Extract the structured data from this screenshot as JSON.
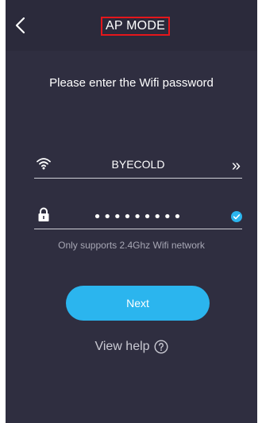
{
  "header": {
    "title": "AP MODE",
    "back_icon": "chevron-left-icon"
  },
  "form": {
    "instruction": "Please enter the Wifi password",
    "ssid": {
      "icon": "wifi-icon",
      "value": "BYECOLD",
      "action_icon": "double-chevron-right-icon",
      "action_glyph": "»"
    },
    "password": {
      "icon": "lock-icon",
      "masked_value": "•••••••••",
      "check_icon": "check-circle-icon"
    },
    "note": "Only supports 2.4Ghz Wifi network"
  },
  "actions": {
    "next_label": "Next",
    "help_label": "View help",
    "help_icon": "question-circle-icon"
  },
  "colors": {
    "background": "#2f2e40",
    "accent": "#2bb5ee",
    "highlight_border": "#e5161b"
  }
}
